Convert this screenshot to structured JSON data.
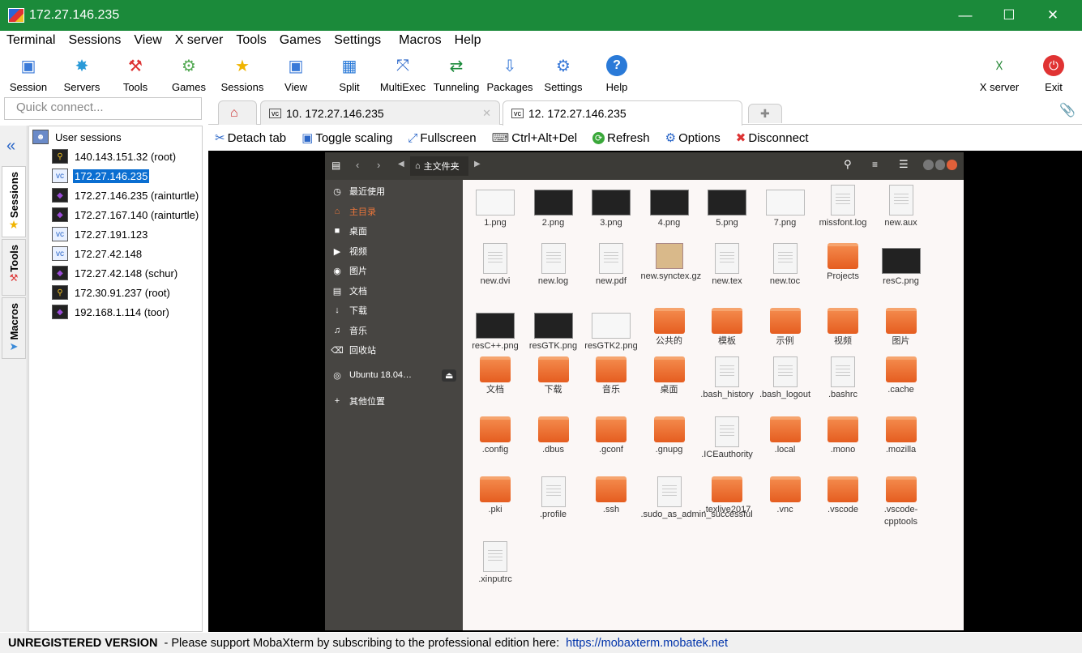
{
  "window": {
    "title": "172.27.146.235"
  },
  "menu": [
    "Terminal",
    "Sessions",
    "View",
    "X server",
    "Tools",
    "Games",
    "Settings",
    "Macros",
    "Help"
  ],
  "toolbar": {
    "items": [
      "Session",
      "Servers",
      "Tools",
      "Games",
      "Sessions",
      "View",
      "Split",
      "MultiExec",
      "Tunneling",
      "Packages",
      "Settings",
      "Help"
    ],
    "xserver": "X server",
    "exit": "Exit"
  },
  "quick_connect": {
    "placeholder": "Quick connect..."
  },
  "tabs": [
    {
      "label": "10. 172.27.146.235"
    },
    {
      "label": "12. 172.27.146.235"
    }
  ],
  "actions": [
    "Detach tab",
    "Toggle scaling",
    "Fullscreen",
    "Ctrl+Alt+Del",
    "Refresh",
    "Options",
    "Disconnect"
  ],
  "side_tabs": [
    "Sessions",
    "Tools",
    "Macros"
  ],
  "sessions": {
    "root": "User sessions",
    "items": [
      {
        "label": "140.143.151.32 (root)",
        "icon": "ssh-key-icon"
      },
      {
        "label": "172.27.146.235",
        "icon": "vnc-icon"
      },
      {
        "label": "172.27.146.235 (rainturtle)",
        "icon": "gem-icon"
      },
      {
        "label": "172.27.167.140 (rainturtle)",
        "icon": "gem-icon"
      },
      {
        "label": "172.27.191.123",
        "icon": "vnc-icon"
      },
      {
        "label": "172.27.42.148",
        "icon": "vnc-icon"
      },
      {
        "label": "172.27.42.148 (schur)",
        "icon": "gem-icon"
      },
      {
        "label": "172.30.91.237 (root)",
        "icon": "ssh-key-icon"
      },
      {
        "label": "192.168.1.114 (toor)",
        "icon": "gem-icon"
      }
    ]
  },
  "remote": {
    "path": "主文件夹",
    "sidebar": [
      "最近使用",
      "主目录",
      "桌面",
      "视频",
      "图片",
      "文档",
      "下载",
      "音乐",
      "回收站",
      "Ubuntu 18.04…",
      "其他位置"
    ],
    "files": [
      {
        "name": "1.png",
        "kind": "light"
      },
      {
        "name": "2.png",
        "kind": "img"
      },
      {
        "name": "3.png",
        "kind": "img"
      },
      {
        "name": "4.png",
        "kind": "img"
      },
      {
        "name": "5.png",
        "kind": "img"
      },
      {
        "name": "7.png",
        "kind": "light"
      },
      {
        "name": "missfont.log",
        "kind": "doc"
      },
      {
        "name": "new.aux",
        "kind": "doc"
      },
      {
        "name": "new.dvi",
        "kind": "doc"
      },
      {
        "name": "new.log",
        "kind": "doc"
      },
      {
        "name": "new.pdf",
        "kind": "doc"
      },
      {
        "name": "new.synctex.gz",
        "kind": "box"
      },
      {
        "name": "new.tex",
        "kind": "doc"
      },
      {
        "name": "new.toc",
        "kind": "doc"
      },
      {
        "name": "Projects",
        "kind": "folder"
      },
      {
        "name": "resC.png",
        "kind": "img"
      },
      {
        "name": "resC++.png",
        "kind": "img"
      },
      {
        "name": "resGTK.png",
        "kind": "img"
      },
      {
        "name": "resGTK2.png",
        "kind": "light"
      },
      {
        "name": "公共的",
        "kind": "folder"
      },
      {
        "name": "模板",
        "kind": "folder"
      },
      {
        "name": "示例",
        "kind": "folder"
      },
      {
        "name": "视频",
        "kind": "folder"
      },
      {
        "name": "图片",
        "kind": "folder"
      },
      {
        "name": "文档",
        "kind": "folder"
      },
      {
        "name": "下载",
        "kind": "folder"
      },
      {
        "name": "音乐",
        "kind": "folder"
      },
      {
        "name": "桌面",
        "kind": "folder"
      },
      {
        "name": ".bash_history",
        "kind": "doc"
      },
      {
        "name": ".bash_logout",
        "kind": "doc"
      },
      {
        "name": ".bashrc",
        "kind": "doc"
      },
      {
        "name": ".cache",
        "kind": "folder"
      },
      {
        "name": ".config",
        "kind": "folder"
      },
      {
        "name": ".dbus",
        "kind": "folder"
      },
      {
        "name": ".gconf",
        "kind": "folder"
      },
      {
        "name": ".gnupg",
        "kind": "folder"
      },
      {
        "name": ".ICEauthority",
        "kind": "doc"
      },
      {
        "name": ".local",
        "kind": "folder"
      },
      {
        "name": ".mono",
        "kind": "folder"
      },
      {
        "name": ".mozilla",
        "kind": "folder"
      },
      {
        "name": ".pki",
        "kind": "folder"
      },
      {
        "name": ".profile",
        "kind": "doc"
      },
      {
        "name": ".ssh",
        "kind": "folder"
      },
      {
        "name": ".sudo_as_admin_successful",
        "kind": "doc"
      },
      {
        "name": ".texlive2017",
        "kind": "folder"
      },
      {
        "name": ".vnc",
        "kind": "folder"
      },
      {
        "name": ".vscode",
        "kind": "folder"
      },
      {
        "name": ".vscode-cpptools",
        "kind": "folder"
      },
      {
        "name": ".xinputrc",
        "kind": "doc"
      }
    ]
  },
  "status": {
    "label": "UNREGISTERED VERSION",
    "message": " -  Please support MobaXterm by subscribing to the professional edition here:",
    "link": "https://mobaxterm.mobatek.net"
  },
  "colors": {
    "titlebar": "#1b8a3a",
    "selection": "#0a6ed1",
    "ubuntu_orange": "#e55d20"
  }
}
